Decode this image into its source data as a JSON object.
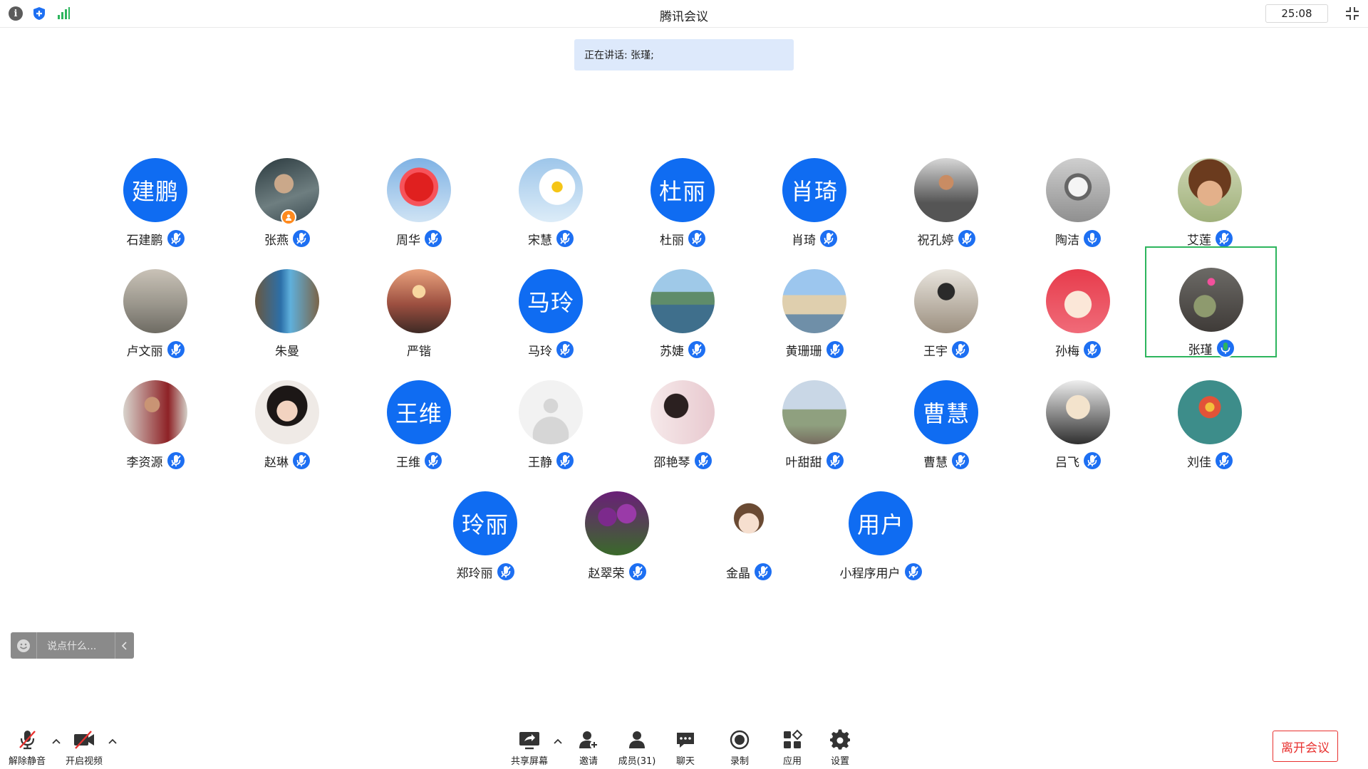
{
  "app": {
    "title": "腾讯会议",
    "timer": "25:08"
  },
  "speaking": {
    "text": "正在讲话: 张瑾;"
  },
  "participants": [
    {
      "name": "石建鹏",
      "avatar_text": "建鹏",
      "photo": "",
      "mic": "muted"
    },
    {
      "name": "张燕",
      "avatar_text": "",
      "photo": "portrait-dark",
      "mic": "muted",
      "host": true
    },
    {
      "name": "周华",
      "avatar_text": "",
      "photo": "red-flower",
      "mic": "muted"
    },
    {
      "name": "宋慧",
      "avatar_text": "",
      "photo": "daisy",
      "mic": "muted"
    },
    {
      "name": "杜丽",
      "avatar_text": "杜丽",
      "photo": "",
      "mic": "muted"
    },
    {
      "name": "肖琦",
      "avatar_text": "肖琦",
      "photo": "",
      "mic": "muted"
    },
    {
      "name": "祝孔婷",
      "avatar_text": "",
      "photo": "man-mask",
      "mic": "muted"
    },
    {
      "name": "陶洁",
      "avatar_text": "",
      "photo": "cat",
      "mic": "on"
    },
    {
      "name": "艾莲",
      "avatar_text": "",
      "photo": "child",
      "mic": "muted"
    },
    {
      "name": "卢文丽",
      "avatar_text": "",
      "photo": "misty",
      "mic": "muted"
    },
    {
      "name": "朱曼",
      "avatar_text": "",
      "photo": "blue-canyon",
      "mic": ""
    },
    {
      "name": "严锴",
      "avatar_text": "",
      "photo": "sunset-city",
      "mic": ""
    },
    {
      "name": "马玲",
      "avatar_text": "马玲",
      "photo": "",
      "mic": "muted"
    },
    {
      "name": "苏婕",
      "avatar_text": "",
      "photo": "lake",
      "mic": "muted"
    },
    {
      "name": "黄珊珊",
      "avatar_text": "",
      "photo": "beach",
      "mic": "muted"
    },
    {
      "name": "王宇",
      "avatar_text": "",
      "photo": "person-indoor",
      "mic": "muted"
    },
    {
      "name": "孙梅",
      "avatar_text": "",
      "photo": "cartoon-red",
      "mic": "muted"
    },
    {
      "name": "张瑾",
      "avatar_text": "",
      "photo": "lotus",
      "mic": "speaking",
      "active": true
    },
    {
      "name": "李资源",
      "avatar_text": "",
      "photo": "office-man",
      "mic": "muted"
    },
    {
      "name": "赵琳",
      "avatar_text": "",
      "photo": "girl-portrait",
      "mic": "muted"
    },
    {
      "name": "王维",
      "avatar_text": "王维",
      "photo": "",
      "mic": "muted"
    },
    {
      "name": "王静",
      "avatar_text": "",
      "photo": "default-user",
      "mic": "muted"
    },
    {
      "name": "邵艳琴",
      "avatar_text": "",
      "photo": "woman-room",
      "mic": "muted"
    },
    {
      "name": "叶甜甜",
      "avatar_text": "",
      "photo": "group-outdoor",
      "mic": "muted"
    },
    {
      "name": "曹慧",
      "avatar_text": "曹慧",
      "photo": "",
      "mic": "muted"
    },
    {
      "name": "吕飞",
      "avatar_text": "",
      "photo": "cartoon-man",
      "mic": "muted"
    },
    {
      "name": "刘佳",
      "avatar_text": "",
      "photo": "flower-teal",
      "mic": "muted"
    },
    {
      "name": "郑玲丽",
      "avatar_text": "玲丽",
      "photo": "",
      "mic": "muted"
    },
    {
      "name": "赵翠荣",
      "avatar_text": "",
      "photo": "tulips",
      "mic": "muted"
    },
    {
      "name": "金晶",
      "avatar_text": "",
      "photo": "cartoon-girl",
      "mic": "muted"
    },
    {
      "name": "小程序用户",
      "avatar_text": "用户",
      "photo": "",
      "mic": "muted"
    }
  ],
  "chat": {
    "placeholder": "说点什么..."
  },
  "toolbar": {
    "unmute": "解除静音",
    "start_video": "开启视频",
    "share": "共享屏幕",
    "invite": "邀请",
    "members": "成员(31)",
    "chat": "聊天",
    "record": "录制",
    "apps": "应用",
    "settings": "设置",
    "leave": "离开会议"
  },
  "colors": {
    "accent": "#0f6cf2",
    "speaking": "#2db55d",
    "leave": "#e8312f",
    "banner": "#dde9fb"
  }
}
